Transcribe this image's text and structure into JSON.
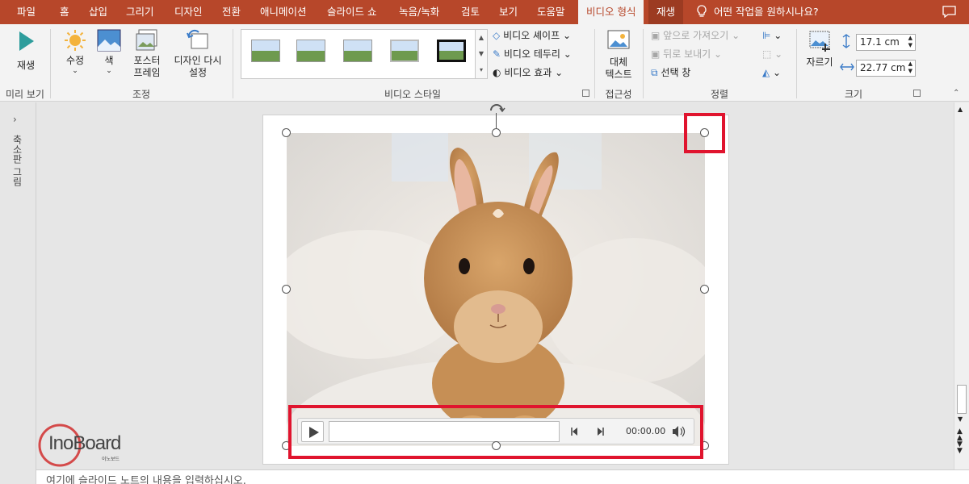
{
  "tabs": [
    "파일",
    "홈",
    "삽입",
    "그리기",
    "디자인",
    "전환",
    "애니메이션",
    "슬라이드 쇼",
    "녹음/녹화",
    "검토",
    "보기",
    "도움말"
  ],
  "active_tab": "비디오 형식",
  "context_tab": "재생",
  "tell_me": "어떤 작업을 원하시나요?",
  "ribbon": {
    "preview": {
      "play": "재생",
      "label": "미리 보기"
    },
    "adjust": {
      "correct": "수정",
      "color": "색",
      "poster1": "포스터",
      "poster2": "프레임",
      "reset1": "디자인 다시",
      "reset2": "설정",
      "label": "조정"
    },
    "styles": {
      "shape": "비디오 셰이프",
      "border": "비디오 테두리",
      "effects": "비디오 효과",
      "label": "비디오 스타일"
    },
    "access": {
      "alt1": "대체",
      "alt2": "텍스트",
      "label": "접근성"
    },
    "arrange": {
      "forward": "앞으로 가져오기",
      "backward": "뒤로 보내기",
      "pane": "선택 창",
      "label": "정렬"
    },
    "size": {
      "crop": "자르기",
      "height": "17.1 cm",
      "width": "22.77 cm",
      "label": "크기"
    }
  },
  "left_pane_label": "축소판 그림",
  "video": {
    "time": "00:00.00"
  },
  "notes_placeholder": "여기에 슬라이드 노트의 내용을 입력하십시오.",
  "watermark": {
    "brand": "InoBoard",
    "sub": "이노보드"
  },
  "colors": {
    "accent": "#b7472a",
    "highlight": "#e0142e"
  }
}
